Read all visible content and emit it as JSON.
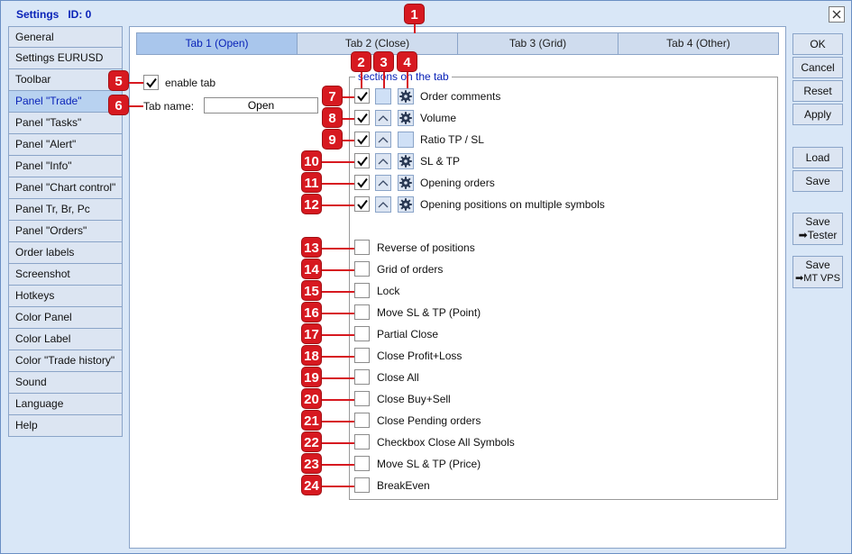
{
  "window": {
    "title": "Settings",
    "id_label": "ID: 0"
  },
  "nav": {
    "items": [
      {
        "label": "General",
        "active": false
      },
      {
        "label": "Settings EURUSD",
        "active": false
      },
      {
        "label": "Toolbar",
        "active": false
      },
      {
        "label": "Panel \"Trade\"",
        "active": true
      },
      {
        "label": "Panel \"Tasks\"",
        "active": false
      },
      {
        "label": "Panel \"Alert\"",
        "active": false
      },
      {
        "label": "Panel \"Info\"",
        "active": false
      },
      {
        "label": "Panel \"Chart control\"",
        "active": false
      },
      {
        "label": "Panel Tr, Br, Pc",
        "active": false
      },
      {
        "label": "Panel \"Orders\"",
        "active": false
      },
      {
        "label": "Order labels",
        "active": false
      },
      {
        "label": "Screenshot",
        "active": false
      },
      {
        "label": "Hotkeys",
        "active": false
      },
      {
        "label": "Color Panel",
        "active": false
      },
      {
        "label": "Color Label",
        "active": false
      },
      {
        "label": "Color \"Trade history\"",
        "active": false
      },
      {
        "label": "Sound",
        "active": false
      },
      {
        "label": "Language",
        "active": false
      },
      {
        "label": "Help",
        "active": false
      }
    ]
  },
  "tabs": [
    {
      "label": "Tab 1 (Open)",
      "active": true
    },
    {
      "label": "Tab 2 (Close)",
      "active": false
    },
    {
      "label": "Tab 3 (Grid)",
      "active": false
    },
    {
      "label": "Tab 4 (Other)",
      "active": false
    }
  ],
  "buttons": {
    "ok": "OK",
    "cancel": "Cancel",
    "reset": "Reset",
    "apply": "Apply",
    "load": "Load",
    "save": "Save",
    "save_tester_line1": "Save",
    "save_tester_line2": "➡Tester",
    "save_vps_line1": "Save",
    "save_vps_line2": "➡MT VPS"
  },
  "enable_tab": {
    "label": "enable tab",
    "checked": true
  },
  "tab_name": {
    "label": "Tab name:",
    "value": "Open"
  },
  "sections_title": "sections on the tab",
  "sections_ordered": [
    {
      "label": "Order comments",
      "checked": true,
      "up": false,
      "gear": true
    },
    {
      "label": "Volume",
      "checked": true,
      "up": true,
      "gear": true
    },
    {
      "label": "Ratio TP / SL",
      "checked": true,
      "up": true,
      "gear": false
    },
    {
      "label": "SL & TP",
      "checked": true,
      "up": true,
      "gear": true
    },
    {
      "label": "Opening orders",
      "checked": true,
      "up": true,
      "gear": true
    },
    {
      "label": "Opening positions on multiple symbols",
      "checked": true,
      "up": true,
      "gear": true
    }
  ],
  "sections_unchecked": [
    {
      "label": "Reverse of positions",
      "checked": false
    },
    {
      "label": "Grid of orders",
      "checked": false
    },
    {
      "label": "Lock",
      "checked": false
    },
    {
      "label": "Move SL & TP (Point)",
      "checked": false
    },
    {
      "label": "Partial Close",
      "checked": false
    },
    {
      "label": "Close Profit+Loss",
      "checked": false
    },
    {
      "label": "Close All",
      "checked": false
    },
    {
      "label": "Close Buy+Sell",
      "checked": false
    },
    {
      "label": "Close Pending orders",
      "checked": false
    },
    {
      "label": "Checkbox Close All Symbols",
      "checked": false
    },
    {
      "label": "Move SL & TP (Price)",
      "checked": false
    },
    {
      "label": "BreakEven",
      "checked": false
    }
  ],
  "callouts": [
    "1",
    "2",
    "3",
    "4",
    "5",
    "6",
    "7",
    "8",
    "9",
    "10",
    "11",
    "12",
    "13",
    "14",
    "15",
    "16",
    "17",
    "18",
    "19",
    "20",
    "21",
    "22",
    "23",
    "24"
  ],
  "colors": {
    "accent": "#0a23b8",
    "callout": "#d71920",
    "window_bg": "#d9e7f7"
  }
}
